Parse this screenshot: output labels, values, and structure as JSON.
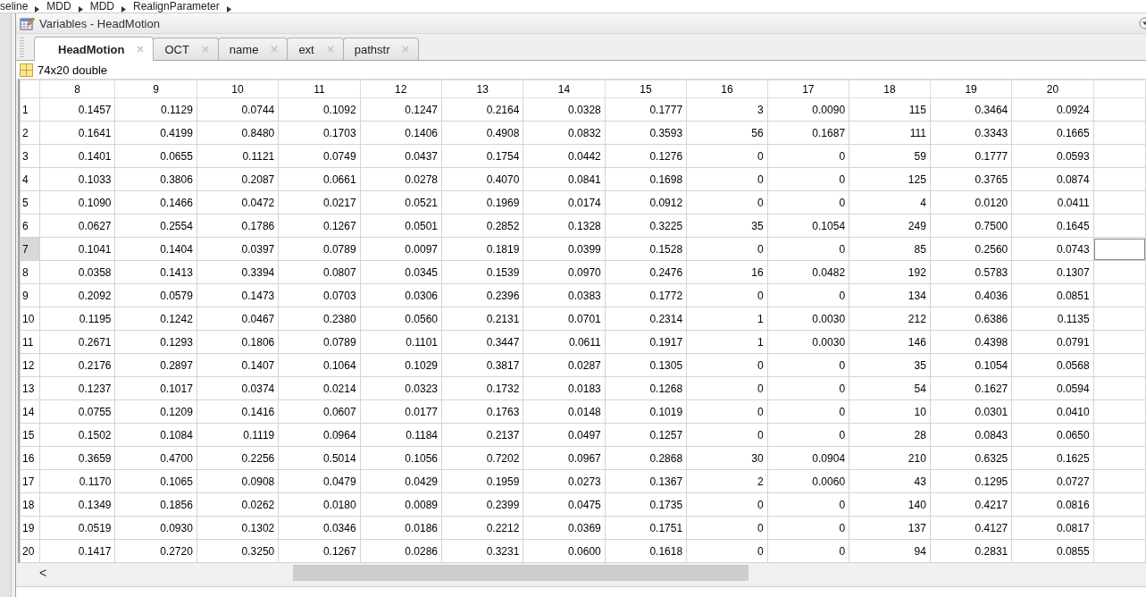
{
  "breadcrumb": [
    "seline",
    "MDD",
    "MDD",
    "RealignParameter"
  ],
  "window": {
    "title": "Variables - HeadMotion"
  },
  "tabs": [
    {
      "label": "HeadMotion",
      "selected": true
    },
    {
      "label": "OCT",
      "selected": false
    },
    {
      "label": "name",
      "selected": false
    },
    {
      "label": "ext",
      "selected": false
    },
    {
      "label": "pathstr",
      "selected": false
    }
  ],
  "variable_info": "74x20 double",
  "table": {
    "columns": [
      "8",
      "9",
      "10",
      "11",
      "12",
      "13",
      "14",
      "15",
      "16",
      "17",
      "18",
      "19",
      "20"
    ],
    "rows": [
      {
        "label": "1",
        "selected": false,
        "cells": [
          "0.1457",
          "0.1129",
          "0.0744",
          "0.1092",
          "0.1247",
          "0.2164",
          "0.0328",
          "0.1777",
          "3",
          "0.0090",
          "115",
          "0.3464",
          "0.0924"
        ]
      },
      {
        "label": "2",
        "selected": false,
        "cells": [
          "0.1641",
          "0.4199",
          "0.8480",
          "0.1703",
          "0.1406",
          "0.4908",
          "0.0832",
          "0.3593",
          "56",
          "0.1687",
          "111",
          "0.3343",
          "0.1665"
        ]
      },
      {
        "label": "3",
        "selected": false,
        "cells": [
          "0.1401",
          "0.0655",
          "0.1121",
          "0.0749",
          "0.0437",
          "0.1754",
          "0.0442",
          "0.1276",
          "0",
          "0",
          "59",
          "0.1777",
          "0.0593"
        ]
      },
      {
        "label": "4",
        "selected": false,
        "cells": [
          "0.1033",
          "0.3806",
          "0.2087",
          "0.0661",
          "0.0278",
          "0.4070",
          "0.0841",
          "0.1698",
          "0",
          "0",
          "125",
          "0.3765",
          "0.0874"
        ]
      },
      {
        "label": "5",
        "selected": false,
        "cells": [
          "0.1090",
          "0.1466",
          "0.0472",
          "0.0217",
          "0.0521",
          "0.1969",
          "0.0174",
          "0.0912",
          "0",
          "0",
          "4",
          "0.0120",
          "0.0411"
        ]
      },
      {
        "label": "6",
        "selected": false,
        "cells": [
          "0.0627",
          "0.2554",
          "0.1786",
          "0.1267",
          "0.0501",
          "0.2852",
          "0.1328",
          "0.3225",
          "35",
          "0.1054",
          "249",
          "0.7500",
          "0.1645"
        ]
      },
      {
        "label": "7",
        "selected": true,
        "cells": [
          "0.1041",
          "0.1404",
          "0.0397",
          "0.0789",
          "0.0097",
          "0.1819",
          "0.0399",
          "0.1528",
          "0",
          "0",
          "85",
          "0.2560",
          "0.0743"
        ]
      },
      {
        "label": "8",
        "selected": false,
        "cells": [
          "0.0358",
          "0.1413",
          "0.3394",
          "0.0807",
          "0.0345",
          "0.1539",
          "0.0970",
          "0.2476",
          "16",
          "0.0482",
          "192",
          "0.5783",
          "0.1307"
        ]
      },
      {
        "label": "9",
        "selected": false,
        "cells": [
          "0.2092",
          "0.0579",
          "0.1473",
          "0.0703",
          "0.0306",
          "0.2396",
          "0.0383",
          "0.1772",
          "0",
          "0",
          "134",
          "0.4036",
          "0.0851"
        ]
      },
      {
        "label": "10",
        "selected": false,
        "cells": [
          "0.1195",
          "0.1242",
          "0.0467",
          "0.2380",
          "0.0560",
          "0.2131",
          "0.0701",
          "0.2314",
          "1",
          "0.0030",
          "212",
          "0.6386",
          "0.1135"
        ]
      },
      {
        "label": "11",
        "selected": false,
        "cells": [
          "0.2671",
          "0.1293",
          "0.1806",
          "0.0789",
          "0.1101",
          "0.3447",
          "0.0611",
          "0.1917",
          "1",
          "0.0030",
          "146",
          "0.4398",
          "0.0791"
        ]
      },
      {
        "label": "12",
        "selected": false,
        "cells": [
          "0.2176",
          "0.2897",
          "0.1407",
          "0.1064",
          "0.1029",
          "0.3817",
          "0.0287",
          "0.1305",
          "0",
          "0",
          "35",
          "0.1054",
          "0.0568"
        ]
      },
      {
        "label": "13",
        "selected": false,
        "cells": [
          "0.1237",
          "0.1017",
          "0.0374",
          "0.0214",
          "0.0323",
          "0.1732",
          "0.0183",
          "0.1268",
          "0",
          "0",
          "54",
          "0.1627",
          "0.0594"
        ]
      },
      {
        "label": "14",
        "selected": false,
        "cells": [
          "0.0755",
          "0.1209",
          "0.1416",
          "0.0607",
          "0.0177",
          "0.1763",
          "0.0148",
          "0.1019",
          "0",
          "0",
          "10",
          "0.0301",
          "0.0410"
        ]
      },
      {
        "label": "15",
        "selected": false,
        "cells": [
          "0.1502",
          "0.1084",
          "0.1119",
          "0.0964",
          "0.1184",
          "0.2137",
          "0.0497",
          "0.1257",
          "0",
          "0",
          "28",
          "0.0843",
          "0.0650"
        ]
      },
      {
        "label": "16",
        "selected": false,
        "cells": [
          "0.3659",
          "0.4700",
          "0.2256",
          "0.5014",
          "0.1056",
          "0.7202",
          "0.0967",
          "0.2868",
          "30",
          "0.0904",
          "210",
          "0.6325",
          "0.1625"
        ]
      },
      {
        "label": "17",
        "selected": false,
        "cells": [
          "0.1170",
          "0.1065",
          "0.0908",
          "0.0479",
          "0.0429",
          "0.1959",
          "0.0273",
          "0.1367",
          "2",
          "0.0060",
          "43",
          "0.1295",
          "0.0727"
        ]
      },
      {
        "label": "18",
        "selected": false,
        "cells": [
          "0.1349",
          "0.1856",
          "0.0262",
          "0.0180",
          "0.0089",
          "0.2399",
          "0.0475",
          "0.1735",
          "0",
          "0",
          "140",
          "0.4217",
          "0.0816"
        ]
      },
      {
        "label": "19",
        "selected": false,
        "cells": [
          "0.0519",
          "0.0930",
          "0.1302",
          "0.0346",
          "0.0186",
          "0.2212",
          "0.0369",
          "0.1751",
          "0",
          "0",
          "137",
          "0.4127",
          "0.0817"
        ]
      },
      {
        "label": "20",
        "selected": false,
        "cells": [
          "0.1417",
          "0.2720",
          "0.3250",
          "0.1267",
          "0.0286",
          "0.3231",
          "0.0600",
          "0.1618",
          "0",
          "0",
          "94",
          "0.2831",
          "0.0855"
        ]
      }
    ]
  },
  "scrollbar": {
    "left_arrow": "<"
  }
}
